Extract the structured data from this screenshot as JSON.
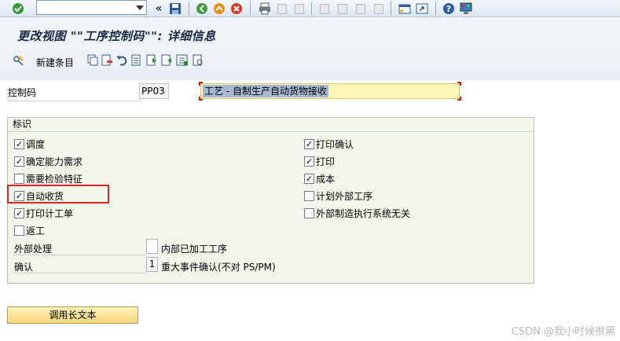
{
  "title": "更改视图 \"\"工序控制码\"\": 详细信息",
  "toolbar": {
    "new_entries": "新建条目"
  },
  "control_code": {
    "label": "控制码",
    "value": "PP03",
    "description": "工艺 - 自制生产自动货物接收"
  },
  "group": {
    "title": "标识",
    "left": [
      {
        "label": "调度",
        "checked": true
      },
      {
        "label": "确定能力需求",
        "checked": true
      },
      {
        "label": "需要检验特征",
        "checked": false
      },
      {
        "label": "自动收货",
        "checked": true
      },
      {
        "label": "打印计工单",
        "checked": true
      },
      {
        "label": "返工",
        "checked": false
      }
    ],
    "right": [
      {
        "label": "打印确认",
        "checked": true
      },
      {
        "label": "打印",
        "checked": true
      },
      {
        "label": "成本",
        "checked": true
      },
      {
        "label": "计划外部工序",
        "checked": false
      },
      {
        "label": "外部制造执行系统无关",
        "checked": false
      }
    ],
    "external_processing": {
      "label": "外部处理",
      "value": "",
      "description": "内部已加工工序"
    },
    "confirmation": {
      "label": "确认",
      "value": "1",
      "description": "重大事件确认(不对 PS/PM)"
    }
  },
  "long_text_button": "调用长文本",
  "watermark": "CSDN @我小时候很黑",
  "colors": {
    "highlight_border": "#d9262b",
    "description_field": "#fff6b8",
    "group_background": "#f2f6ea"
  },
  "icons": [
    "enter-icon",
    "back-icon",
    "save-icon",
    "back-green-icon",
    "exit-icon",
    "cancel-icon",
    "print-icon",
    "find-icon",
    "find-next-icon",
    "first-page-icon",
    "prev-page-icon",
    "next-page-icon",
    "last-page-icon",
    "new-session-icon",
    "shortcut-icon",
    "help-icon",
    "layout-menu-icon"
  ]
}
